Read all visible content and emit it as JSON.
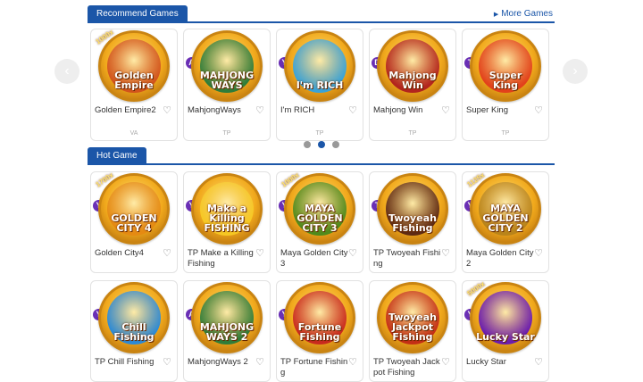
{
  "recommend": {
    "title": "Recommend Games",
    "more_label": "More Games",
    "games": [
      {
        "name": "Golden Empire2",
        "provider": "VA",
        "art_title": "Golden Empire",
        "badge": "",
        "mult": "1000x",
        "inner": "#d2541c"
      },
      {
        "name": "MahjongWays",
        "provider": "TP",
        "art_title": "MAHJONG WAYS",
        "badge": "A",
        "mult": "",
        "inner": "#2f7d3a"
      },
      {
        "name": "I'm RICH",
        "provider": "TP",
        "art_title": "I'm RICH",
        "badge": "Y",
        "mult": "",
        "inner": "#3aa3d8"
      },
      {
        "name": "Mahjong Win",
        "provider": "TP",
        "art_title": "Mahjong Win",
        "badge": "D",
        "mult": "",
        "inner": "#b2241e"
      },
      {
        "name": "Super King",
        "provider": "TP",
        "art_title": "Super King",
        "badge": "T",
        "mult": "",
        "inner": "#e2411b"
      }
    ]
  },
  "hot": {
    "title": "Hot Game",
    "games": [
      {
        "name": "Golden City4",
        "art_title": "GOLDEN CITY 4",
        "badge": "Y",
        "mult": "1700x",
        "inner": "#e58a12"
      },
      {
        "name": "TP Make a Killing Fishing",
        "art_title": "Make a Killing FISHING",
        "badge": "Y",
        "mult": "",
        "inner": "#f6c823"
      },
      {
        "name": "Maya Golden City3",
        "art_title": "MAYA GOLDEN CITY 3",
        "badge": "Y",
        "mult": "1000x",
        "inner": "#4f8a1c"
      },
      {
        "name": "TP Twoyeah Fishing",
        "art_title": "Twoyeah Fishing",
        "badge": "T",
        "mult": "",
        "inner": "#5e2a14"
      },
      {
        "name": "Maya Golden City 2",
        "art_title": "MAYA GOLDEN CITY 2",
        "badge": "Y",
        "mult": "1125x",
        "inner": "#b9841a"
      }
    ],
    "games2": [
      {
        "name": "TP Chill Fishing",
        "art_title": "Chill Fishing",
        "badge": "Y",
        "mult": "",
        "inner": "#2c8ad6"
      },
      {
        "name": "MahjongWays 2",
        "art_title": "MAHJONG WAYS 2",
        "badge": "A",
        "mult": "",
        "inner": "#2f7d3a"
      },
      {
        "name": "TP Fortune Fishing",
        "art_title": "Fortune Fishing",
        "badge": "Y",
        "mult": "",
        "inner": "#c92a1f"
      },
      {
        "name": "TP Twoyeah Jackpot Fishing",
        "art_title": "Twoyeah Jackpot Fishing",
        "badge": "",
        "mult": "",
        "inner": "#c42f16"
      },
      {
        "name": "Lucky Star",
        "art_title": "Lucky Star",
        "badge": "Y",
        "mult": "5000x",
        "inner": "#6a1cb0"
      }
    ]
  },
  "carousel": {
    "prev_icon": "‹",
    "next_icon": "›",
    "active_dot": 1,
    "dot_count": 3
  },
  "colors": {
    "accent": "#1b56a8"
  }
}
